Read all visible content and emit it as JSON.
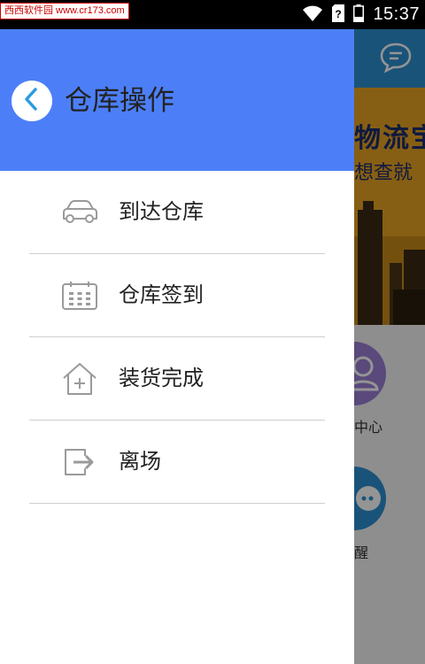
{
  "status_bar": {
    "watermark": "西西软件园 www.cr173.com",
    "time": "15:37"
  },
  "drawer": {
    "title": "仓库操作",
    "items": [
      {
        "label": "到达仓库",
        "icon": "car-icon"
      },
      {
        "label": "仓库签到",
        "icon": "calendar-icon"
      },
      {
        "label": "装货完成",
        "icon": "house-plus-icon"
      },
      {
        "label": "离场",
        "icon": "exit-icon"
      }
    ]
  },
  "background": {
    "banner_title": "物流宝",
    "banner_subtitle": "想查就",
    "tile1_label": "中心",
    "tile2_label": "醒"
  },
  "colors": {
    "header": "#4c7ff7",
    "back_icon": "#2c9be0",
    "icon_gray": "#9a9a9a"
  }
}
